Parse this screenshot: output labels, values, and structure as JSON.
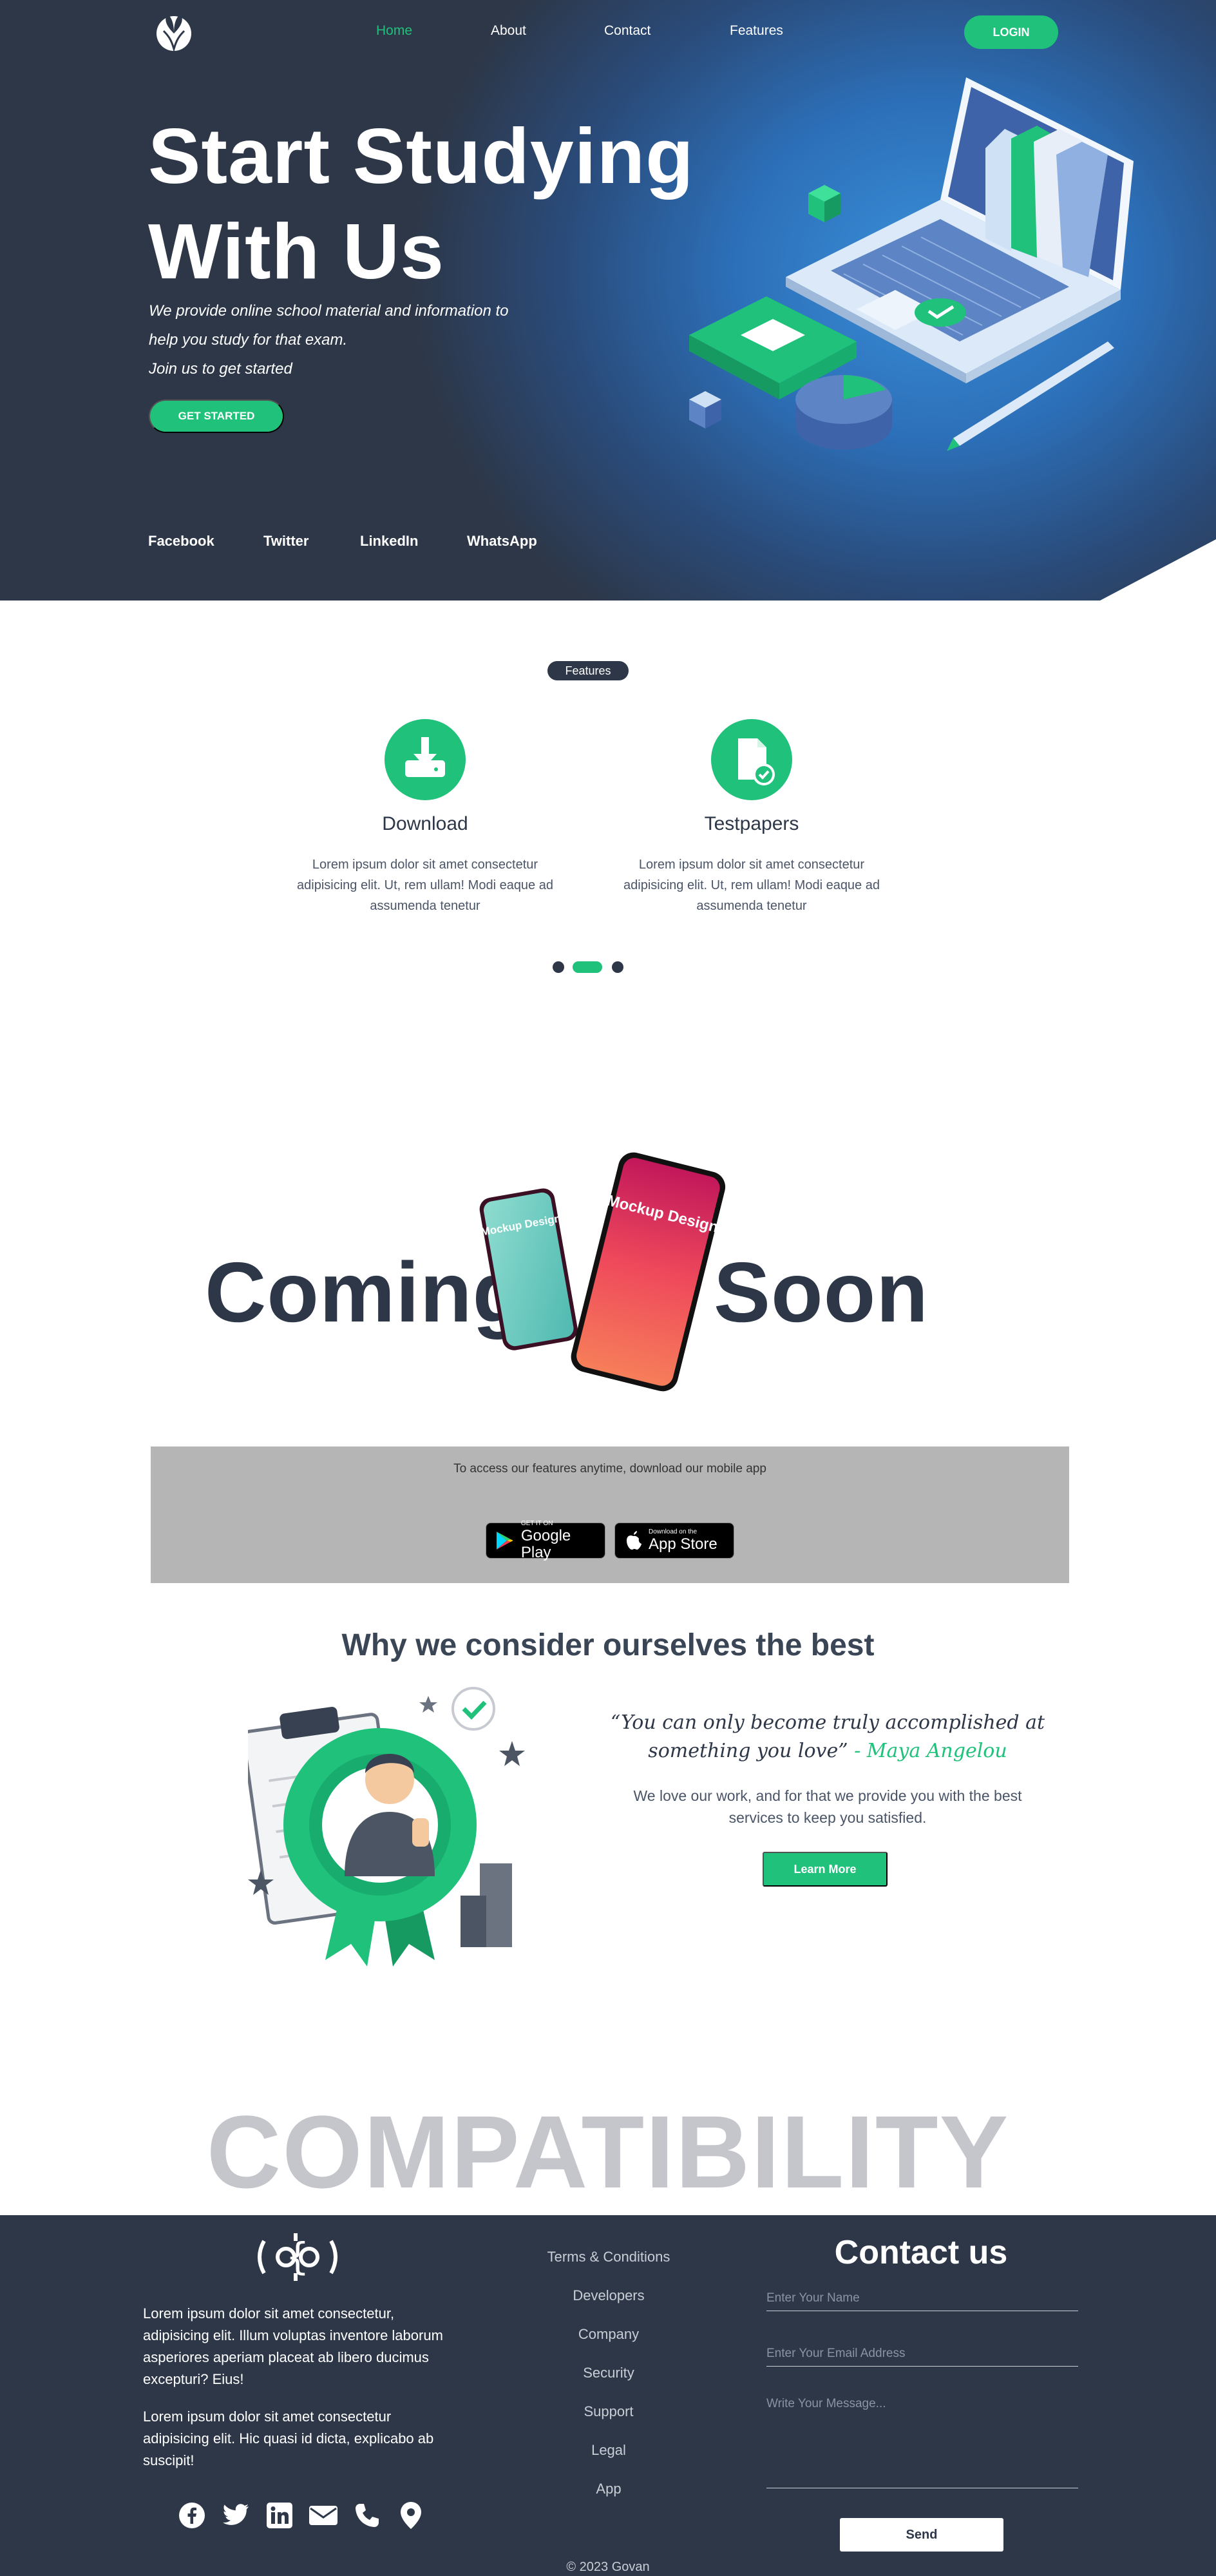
{
  "nav": {
    "items": [
      "Home",
      "About",
      "Contact",
      "Features"
    ],
    "active": "Home",
    "login_label": "LOGIN"
  },
  "hero": {
    "title_line1": "Start Studying",
    "title_line2": "With Us",
    "subtitle_line1": "We provide online school material and information to",
    "subtitle_line2": "help you study for that exam.",
    "subtitle_line3": "Join us to get started",
    "cta_label": "GET STARTED",
    "social": [
      "Facebook",
      "Twitter",
      "LinkedIn",
      "WhatsApp"
    ]
  },
  "features": {
    "pill_label": "Features",
    "cards": [
      {
        "icon": "download-icon",
        "title": "Download",
        "text": "Lorem ipsum dolor sit amet consectetur adipisicing elit. Ut, rem ullam! Modi eaque ad assumenda tenetur"
      },
      {
        "icon": "testpaper-icon",
        "title": "Testpapers",
        "text": "Lorem ipsum dolor sit amet consectetur adipisicing elit. Ut, rem ullam! Modi eaque ad assumenda tenetur"
      }
    ],
    "carousel": {
      "count": 3,
      "active_index": 1
    }
  },
  "coming_soon": {
    "word1": "Coming",
    "word2": "Soon",
    "phone_text_small": "Mockup Design",
    "phone_text_large": "Mockup Design",
    "download_text": "To access our features anytime, download our mobile app",
    "google_play_small": "GET IT ON",
    "google_play_big": "Google Play",
    "app_store_small": "Download on the",
    "app_store_big": "App Store"
  },
  "why": {
    "title": "Why we consider ourselves the best",
    "quote": "“You can only become truly accomplished at something you love”",
    "quote_author": "- Maya Angelou",
    "text": "We love our work, and for that we provide you with the best services to keep you satisfied.",
    "button_label": "Learn More"
  },
  "compatibility": "COMPATIBILITY",
  "footer": {
    "paragraph1": "Lorem ipsum dolor sit amet consectetur, adipisicing elit. Illum voluptas inventore laborum asperiores aperiam placeat ab libero ducimus excepturi? Eius!",
    "paragraph2": "Lorem ipsum dolor sit amet consectetur adipisicing elit. Hic quasi id dicta, explicabo ab suscipit!",
    "links": [
      "Terms & Conditions",
      "Developers",
      "Company",
      "Security",
      "Support",
      "Legal",
      "App"
    ],
    "contact_title": "Contact us",
    "name_placeholder": "Enter Your Name",
    "email_placeholder": "Enter Your Email Address",
    "message_placeholder": "Write Your Message...",
    "send_label": "Send",
    "icons": [
      "facebook-icon",
      "twitter-icon",
      "linkedin-icon",
      "email-icon",
      "phone-icon",
      "location-icon"
    ],
    "copyright": "© 2023 Govan"
  },
  "colors": {
    "accent": "#1fc17b",
    "dark": "#2d3748",
    "hero_blue": "#3a8fd9",
    "gray_box": "#b5b5b5"
  }
}
